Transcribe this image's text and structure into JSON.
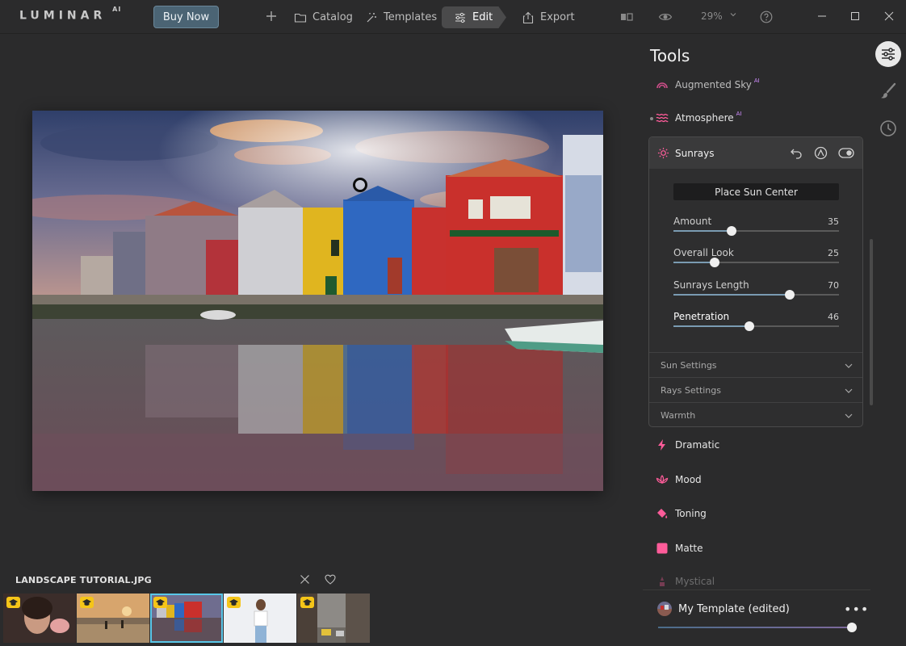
{
  "app": {
    "logo": "LUMINAR",
    "logo_suffix": "AI",
    "buy_now": "Buy Now"
  },
  "nav": {
    "catalog": "Catalog",
    "templates": "Templates",
    "edit": "Edit",
    "export": "Export",
    "zoom": "29%"
  },
  "tools": {
    "title": "Tools",
    "items": [
      {
        "label": "Augmented Sky",
        "ai": "AI"
      },
      {
        "label": "Atmosphere",
        "ai": "AI"
      },
      {
        "label": "Dramatic"
      },
      {
        "label": "Mood"
      },
      {
        "label": "Toning"
      },
      {
        "label": "Matte"
      },
      {
        "label": "Mystical"
      }
    ],
    "sunrays": {
      "title": "Sunrays",
      "place_sun_center": "Place Sun Center",
      "sliders": [
        {
          "label": "Amount",
          "value": "35",
          "level": 35
        },
        {
          "label": "Overall Look",
          "value": "25",
          "level": 25
        },
        {
          "label": "Sunrays Length",
          "value": "70",
          "level": 70
        },
        {
          "label": "Penetration",
          "value": "46",
          "level": 46
        }
      ],
      "sections": [
        "Sun Settings",
        "Rays Settings",
        "Warmth"
      ]
    }
  },
  "template": {
    "name": "My Template (edited)",
    "more": "•••",
    "amount_level": 100
  },
  "filmstrip": {
    "title": "LANDSCAPE TUTORIAL.JPG"
  },
  "colors": {
    "accent": "#59c7e8",
    "tool_icon": "#ff5c9a",
    "buy_bg": "#4b6474"
  },
  "icons": {
    "catalog": "folder-icon",
    "templates": "magic-wand-icon",
    "edit": "sliders-icon",
    "export": "export-icon"
  }
}
